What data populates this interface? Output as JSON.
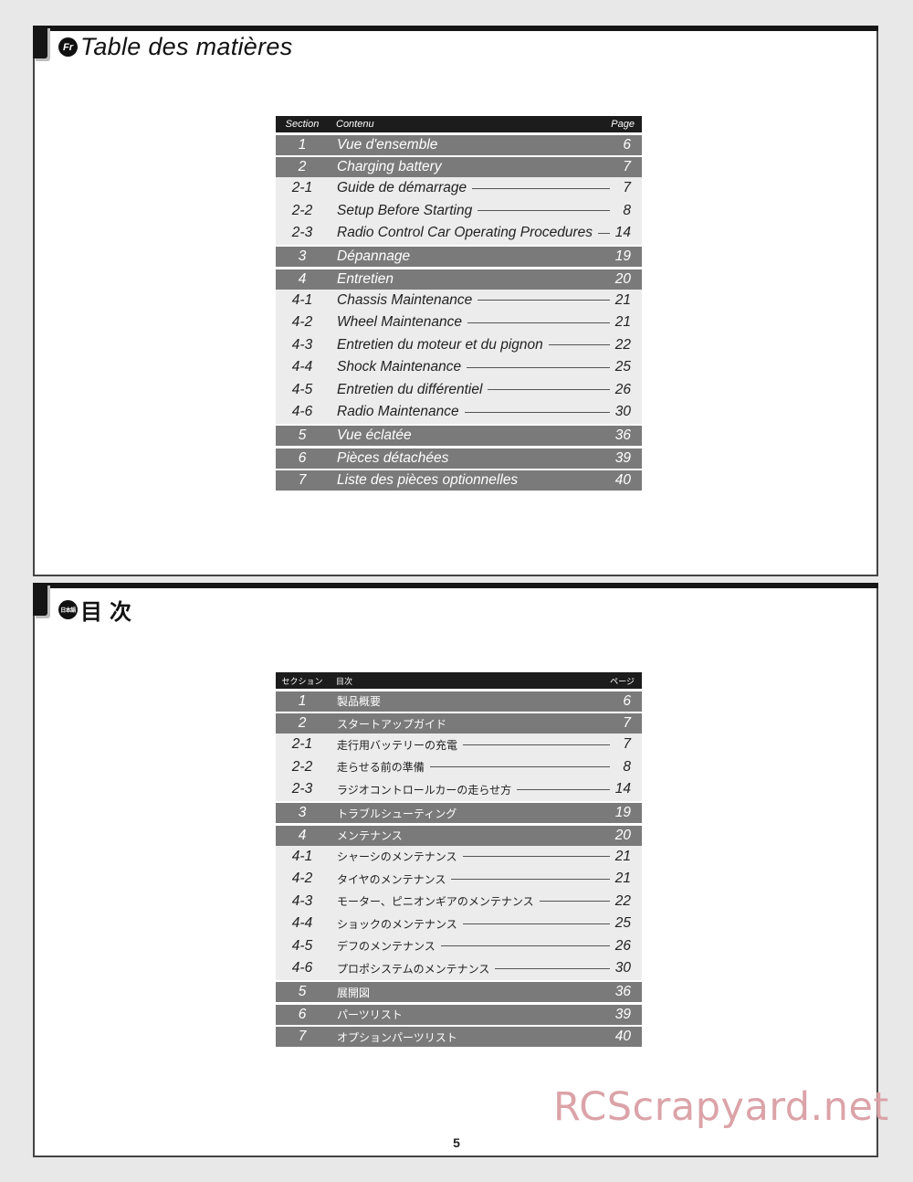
{
  "french_section": {
    "lang_badge": "Fr",
    "heading": "Table des matières",
    "columns": {
      "section": "Section",
      "content": "Contenu",
      "page": "Page"
    },
    "rows": [
      {
        "num": "1",
        "title": "Vue d'ensemble",
        "page": "6",
        "type": "main"
      },
      {
        "num": "2",
        "title": "Charging battery",
        "page": "7",
        "type": "main"
      },
      {
        "num": "2-1",
        "title": "Guide de démarrage",
        "page": "7",
        "type": "sub"
      },
      {
        "num": "2-2",
        "title": "Setup Before Starting",
        "page": "8",
        "type": "sub"
      },
      {
        "num": "2-3",
        "title": "Radio Control Car Operating Procedures",
        "page": "14",
        "type": "sub"
      },
      {
        "num": "3",
        "title": "Dépannage",
        "page": "19",
        "type": "main"
      },
      {
        "num": "4",
        "title": "Entretien",
        "page": "20",
        "type": "main"
      },
      {
        "num": "4-1",
        "title": "Chassis Maintenance",
        "page": "21",
        "type": "sub"
      },
      {
        "num": "4-2",
        "title": "Wheel Maintenance",
        "page": "21",
        "type": "sub"
      },
      {
        "num": "4-3",
        "title": "Entretien du moteur et du pignon",
        "page": "22",
        "type": "sub"
      },
      {
        "num": "4-4",
        "title": "Shock Maintenance",
        "page": "25",
        "type": "sub"
      },
      {
        "num": "4-5",
        "title": "Entretien du différentiel",
        "page": "26",
        "type": "sub"
      },
      {
        "num": "4-6",
        "title": "Radio Maintenance",
        "page": "30",
        "type": "sub"
      },
      {
        "num": "5",
        "title": "Vue éclatée",
        "page": "36",
        "type": "main"
      },
      {
        "num": "6",
        "title": "Pièces détachées",
        "page": "39",
        "type": "main"
      },
      {
        "num": "7",
        "title": "Liste des pièces optionnelles",
        "page": "40",
        "type": "main"
      }
    ]
  },
  "japanese_section": {
    "lang_badge": "日本語",
    "heading": "目次",
    "columns": {
      "section": "セクション",
      "content": "目次",
      "page": "ページ"
    },
    "rows": [
      {
        "num": "1",
        "title": "製品概要",
        "page": "6",
        "type": "main"
      },
      {
        "num": "2",
        "title": "スタートアップガイド",
        "page": "7",
        "type": "main"
      },
      {
        "num": "2-1",
        "title": "走行用バッテリーの充電",
        "page": "7",
        "type": "sub"
      },
      {
        "num": "2-2",
        "title": "走らせる前の準備",
        "page": "8",
        "type": "sub"
      },
      {
        "num": "2-3",
        "title": "ラジオコントロールカーの走らせ方",
        "page": "14",
        "type": "sub"
      },
      {
        "num": "3",
        "title": "トラブルシューティング",
        "page": "19",
        "type": "main"
      },
      {
        "num": "4",
        "title": "メンテナンス",
        "page": "20",
        "type": "main"
      },
      {
        "num": "4-1",
        "title": "シャーシのメンテナンス",
        "page": "21",
        "type": "sub"
      },
      {
        "num": "4-2",
        "title": "タイヤのメンテナンス",
        "page": "21",
        "type": "sub"
      },
      {
        "num": "4-3",
        "title": "モーター、ピニオンギアのメンテナンス",
        "page": "22",
        "type": "sub"
      },
      {
        "num": "4-4",
        "title": "ショックのメンテナンス",
        "page": "25",
        "type": "sub"
      },
      {
        "num": "4-5",
        "title": "デフのメンテナンス",
        "page": "26",
        "type": "sub"
      },
      {
        "num": "4-6",
        "title": "プロポシステムのメンテナンス",
        "page": "30",
        "type": "sub"
      },
      {
        "num": "5",
        "title": "展開図",
        "page": "36",
        "type": "main"
      },
      {
        "num": "6",
        "title": "パーツリスト",
        "page": "39",
        "type": "main"
      },
      {
        "num": "7",
        "title": "オプションパーツリスト",
        "page": "40",
        "type": "main"
      }
    ]
  },
  "footer": {
    "page_number": "5",
    "watermark": "RCScrapyard.net"
  },
  "colors": {
    "main_row_bg": "#7a7a7a",
    "sub_row_bg": "#ececec",
    "header_bg": "#1c1c1c",
    "watermark": "#dba3a8"
  }
}
